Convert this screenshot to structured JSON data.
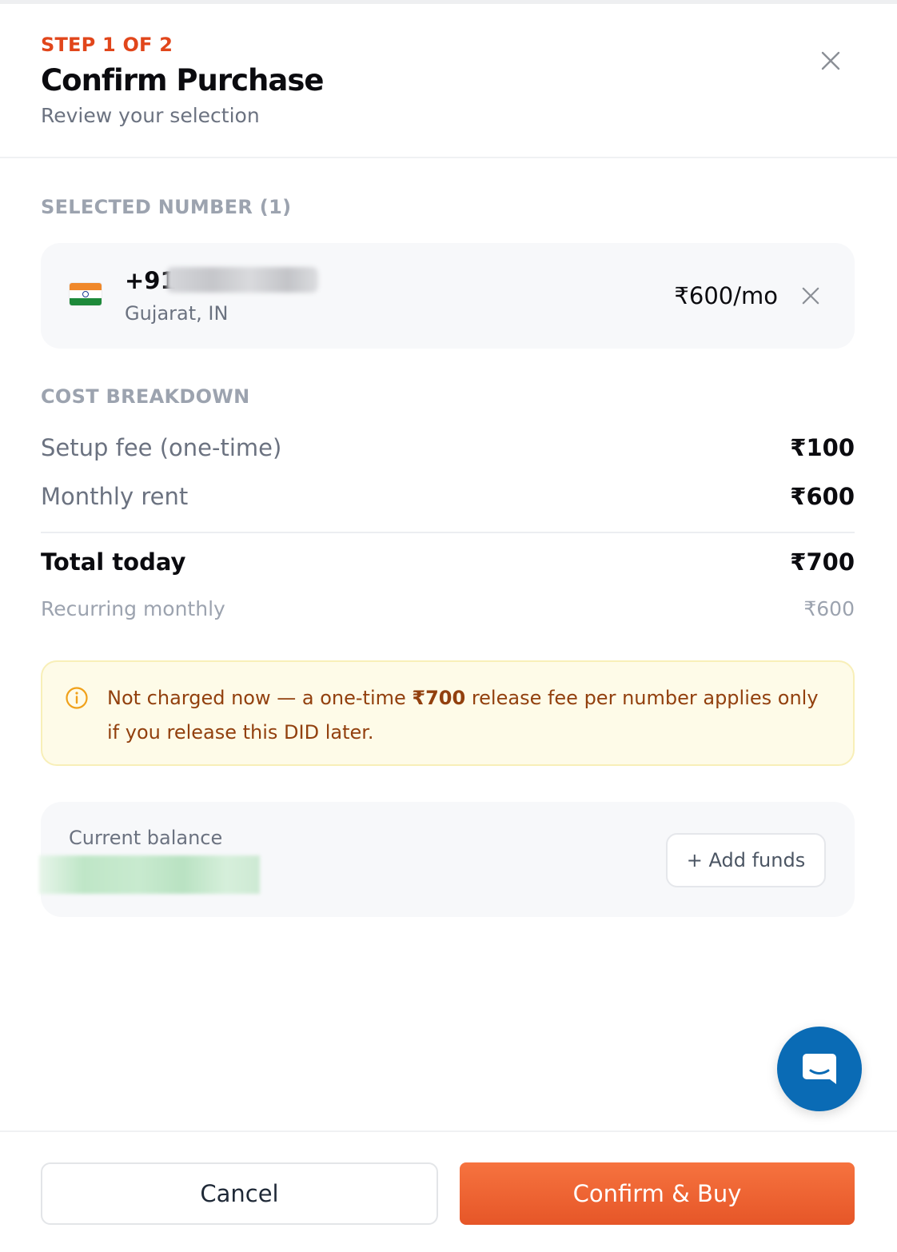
{
  "header": {
    "step": "STEP 1 OF 2",
    "title": "Confirm Purchase",
    "subtitle": "Review your selection",
    "close_icon": "close-icon"
  },
  "selected": {
    "section_label": "SELECTED NUMBER (1)",
    "number": {
      "flag_icon": "india-flag-icon",
      "prefix": "+91",
      "region": "Gujarat, IN",
      "price": "₹600/mo",
      "remove_icon": "close-icon"
    }
  },
  "cost": {
    "section_label": "COST BREAKDOWN",
    "rows": [
      {
        "label": "Setup fee (one-time)",
        "value": "₹100"
      },
      {
        "label": "Monthly rent",
        "value": "₹600"
      }
    ],
    "total": {
      "label": "Total today",
      "value": "₹700"
    },
    "recurring": {
      "label": "Recurring monthly",
      "value": "₹600"
    }
  },
  "notice": {
    "icon": "info-icon",
    "text_before": "Not charged now — a one-time ",
    "amount": "₹700",
    "text_after": " release fee per number applies only if you release this DID later."
  },
  "balance": {
    "label": "Current balance",
    "add_funds_label": "+ Add funds"
  },
  "chat": {
    "icon": "chat-icon"
  },
  "footer": {
    "cancel_label": "Cancel",
    "confirm_label": "Confirm & Buy"
  },
  "colors": {
    "accent": "#e1461b",
    "confirm": "#ee5f31",
    "notice_bg": "#fefbe8",
    "notice_text": "#92400e",
    "chat": "#0a6bb5"
  }
}
